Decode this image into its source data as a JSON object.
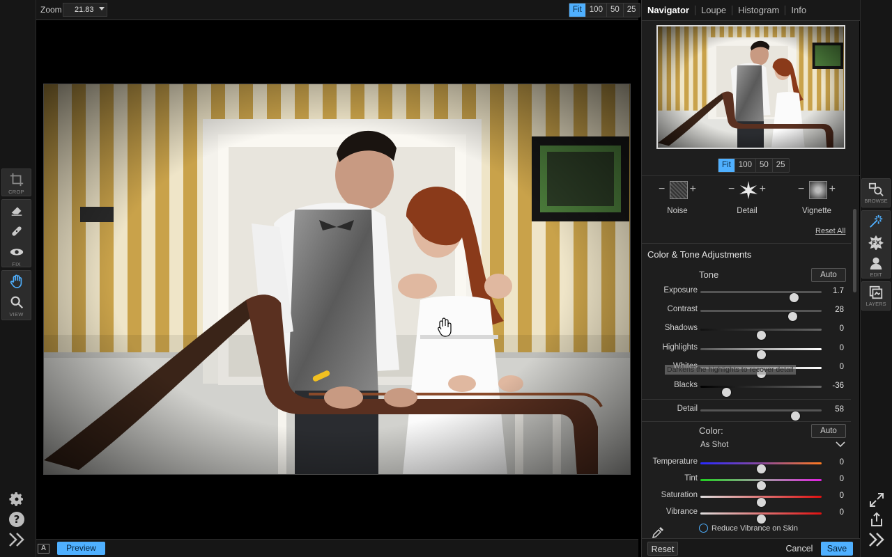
{
  "canvas": {
    "zoom_label": "Zoom",
    "zoom_value": "21.83",
    "zoom_presets": [
      "Fit",
      "100",
      "50",
      "25"
    ],
    "preview_label": "Preview",
    "a_badge": "A"
  },
  "left_tools": {
    "crop_label": "CROP",
    "fix_label": "FIX",
    "view_label": "VIEW"
  },
  "navigator": {
    "tabs": [
      "Navigator",
      "Loupe",
      "Histogram",
      "Info"
    ],
    "zoom_presets": [
      "Fit",
      "100",
      "50",
      "25"
    ]
  },
  "effects": {
    "items": [
      "Noise",
      "Detail",
      "Vignette"
    ],
    "reset_all": "Reset All"
  },
  "adjustments": {
    "title": "Color & Tone Adjustments",
    "tone_header": "Tone",
    "auto_label": "Auto",
    "tone_sliders": [
      {
        "label": "Exposure",
        "value": "1.7",
        "fraction": 0.77
      },
      {
        "label": "Contrast",
        "value": "28",
        "fraction": 0.76
      },
      {
        "label": "Shadows",
        "value": "0",
        "fraction": 0.5
      },
      {
        "label": "Highlights",
        "value": "0",
        "fraction": 0.5
      },
      {
        "label": "Whites",
        "value": "0",
        "fraction": 0.5
      },
      {
        "label": "Blacks",
        "value": "-36",
        "fraction": 0.21
      }
    ],
    "tooltip": "Darkens the highlights to recover detail",
    "detail_slider": {
      "label": "Detail",
      "value": "58",
      "fraction": 0.78
    },
    "color_header": "Color:",
    "color_auto": "Auto",
    "white_balance": "As Shot",
    "color_sliders": [
      {
        "label": "Temperature",
        "value": "0",
        "fraction": 0.5
      },
      {
        "label": "Tint",
        "value": "0",
        "fraction": 0.5
      },
      {
        "label": "Saturation",
        "value": "0",
        "fraction": 0.5
      },
      {
        "label": "Vibrance",
        "value": "0",
        "fraction": 0.5
      }
    ],
    "reduce_vibrance": "Reduce Vibrance on Skin"
  },
  "footer": {
    "reset": "Reset",
    "cancel": "Cancel",
    "save": "Save"
  },
  "modules": {
    "browse_label": "BROWSE",
    "edit_label": "EDIT",
    "layers_label": "LAYERS"
  },
  "colors": {
    "accent": "#4fb0ff",
    "panel": "#1e1e1e",
    "background": "#000000"
  }
}
